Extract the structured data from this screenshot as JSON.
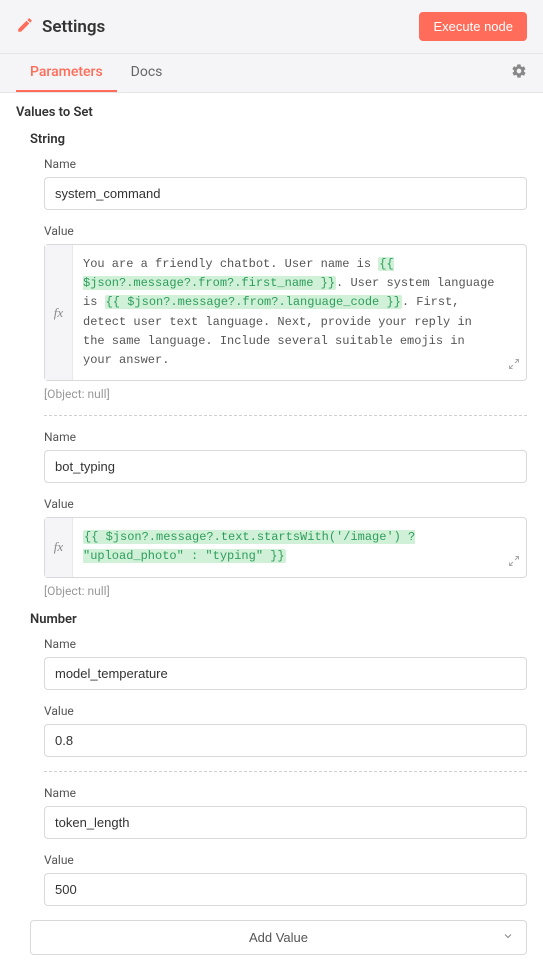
{
  "header": {
    "title": "Settings",
    "execute_label": "Execute node"
  },
  "tabs": {
    "parameters": "Parameters",
    "docs": "Docs"
  },
  "section": {
    "values_to_set": "Values to Set"
  },
  "groups": {
    "string": "String",
    "number": "Number"
  },
  "labels": {
    "name": "Name",
    "value": "Value",
    "object_null": "[Object: null]",
    "add_value": "Add Value",
    "fx": "fx"
  },
  "string_items": [
    {
      "name": "system_command",
      "value_parts": [
        {
          "t": "text",
          "v": "You are a friendly chatbot. User name is "
        },
        {
          "t": "expr",
          "v": "{{ $json?.message?.from?.first_name }}"
        },
        {
          "t": "text",
          "v": ". User system language is "
        },
        {
          "t": "expr",
          "v": "{{ $json?.message?.from?.language_code }}"
        },
        {
          "t": "text",
          "v": ". First, detect user text language. Next, provide your reply in the same language. Include several suitable emojis in your answer."
        }
      ]
    },
    {
      "name": "bot_typing",
      "value_parts": [
        {
          "t": "expr",
          "v": "{{ $json?.message?.text.startsWith('/image') ? \"upload_photo\" : \"typing\" }}"
        }
      ]
    }
  ],
  "number_items": [
    {
      "name": "model_temperature",
      "value": "0.8"
    },
    {
      "name": "token_length",
      "value": "500"
    }
  ]
}
